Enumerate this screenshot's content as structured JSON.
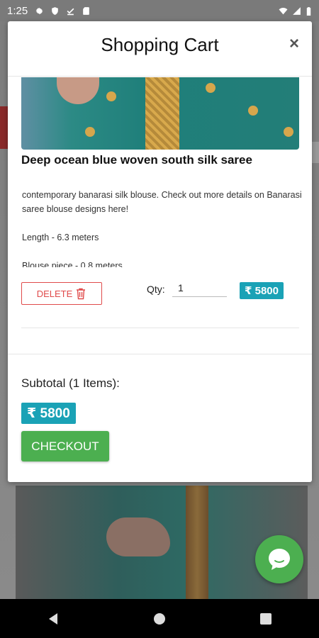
{
  "status_bar": {
    "time": "1:25",
    "icons": [
      "gear-icon",
      "shield-icon",
      "download-done-icon",
      "sd-card-icon"
    ],
    "right_icons": [
      "wifi-icon",
      "signal-icon",
      "battery-icon"
    ]
  },
  "modal": {
    "title": "Shopping Cart",
    "close_label": "×"
  },
  "cart_item": {
    "name": "Deep ocean blue woven south silk saree",
    "description": [
      "contemporary banarasi silk blouse. Check out more details on Banarasi saree blouse designs here!",
      "Length - 6.3 meters",
      "Blouse piece - 0.8 meters"
    ],
    "delete_label": "DELETE",
    "qty_label": "Qty:",
    "qty_value": "1",
    "price": "₹ 5800"
  },
  "summary": {
    "subtotal_label": "Subtotal (1 Items):",
    "subtotal_value": "₹ 5800",
    "checkout_label": "CHECKOUT"
  },
  "colors": {
    "accent": "#1aa2b6",
    "checkout": "#4caf50",
    "delete": "#e04b4b"
  }
}
